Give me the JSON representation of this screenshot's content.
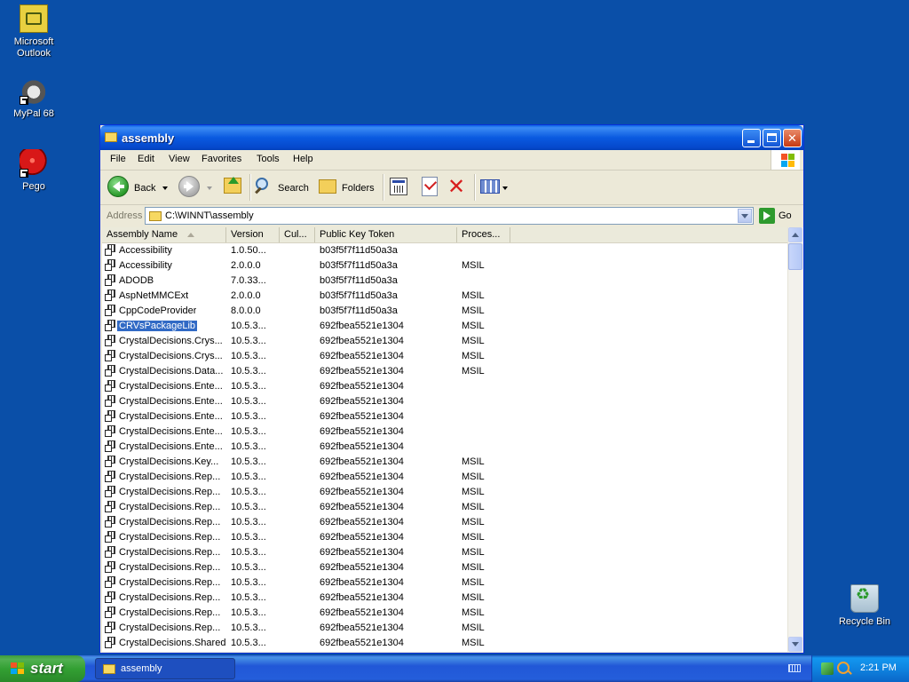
{
  "desktop": {
    "icons": [
      {
        "label_line1": "Microsoft",
        "label_line2": "Outlook"
      },
      {
        "label_line1": "MyPal 68",
        "label_line2": ""
      },
      {
        "label_line1": "Pego",
        "label_line2": ""
      },
      {
        "label_line1": "Recycle Bin",
        "label_line2": ""
      }
    ]
  },
  "window": {
    "title": "assembly",
    "menu": [
      "File",
      "Edit",
      "View",
      "Favorites",
      "Tools",
      "Help"
    ],
    "toolbar": {
      "back": "Back",
      "search": "Search",
      "folders": "Folders"
    },
    "address": {
      "label": "Address",
      "value": "C:\\WINNT\\assembly",
      "go": "Go"
    },
    "columns": [
      "Assembly Name",
      "Version",
      "Cul...",
      "Public Key Token",
      "Proces..."
    ],
    "rows": [
      {
        "name": "Accessibility",
        "version": "1.0.50...",
        "culture": "",
        "token": "b03f5f7f11d50a3a",
        "proc": ""
      },
      {
        "name": "Accessibility",
        "version": "2.0.0.0",
        "culture": "",
        "token": "b03f5f7f11d50a3a",
        "proc": "MSIL"
      },
      {
        "name": "ADODB",
        "version": "7.0.33...",
        "culture": "",
        "token": "b03f5f7f11d50a3a",
        "proc": ""
      },
      {
        "name": "AspNetMMCExt",
        "version": "2.0.0.0",
        "culture": "",
        "token": "b03f5f7f11d50a3a",
        "proc": "MSIL"
      },
      {
        "name": "CppCodeProvider",
        "version": "8.0.0.0",
        "culture": "",
        "token": "b03f5f7f11d50a3a",
        "proc": "MSIL"
      },
      {
        "name": "CRVsPackageLib",
        "version": "10.5.3...",
        "culture": "",
        "token": "692fbea5521e1304",
        "proc": "MSIL",
        "selected": true
      },
      {
        "name": "CrystalDecisions.Crys...",
        "version": "10.5.3...",
        "culture": "",
        "token": "692fbea5521e1304",
        "proc": "MSIL"
      },
      {
        "name": "CrystalDecisions.Crys...",
        "version": "10.5.3...",
        "culture": "",
        "token": "692fbea5521e1304",
        "proc": "MSIL"
      },
      {
        "name": "CrystalDecisions.Data...",
        "version": "10.5.3...",
        "culture": "",
        "token": "692fbea5521e1304",
        "proc": "MSIL"
      },
      {
        "name": "CrystalDecisions.Ente...",
        "version": "10.5.3...",
        "culture": "",
        "token": "692fbea5521e1304",
        "proc": ""
      },
      {
        "name": "CrystalDecisions.Ente...",
        "version": "10.5.3...",
        "culture": "",
        "token": "692fbea5521e1304",
        "proc": ""
      },
      {
        "name": "CrystalDecisions.Ente...",
        "version": "10.5.3...",
        "culture": "",
        "token": "692fbea5521e1304",
        "proc": ""
      },
      {
        "name": "CrystalDecisions.Ente...",
        "version": "10.5.3...",
        "culture": "",
        "token": "692fbea5521e1304",
        "proc": ""
      },
      {
        "name": "CrystalDecisions.Ente...",
        "version": "10.5.3...",
        "culture": "",
        "token": "692fbea5521e1304",
        "proc": ""
      },
      {
        "name": "CrystalDecisions.Key...",
        "version": "10.5.3...",
        "culture": "",
        "token": "692fbea5521e1304",
        "proc": "MSIL"
      },
      {
        "name": "CrystalDecisions.Rep...",
        "version": "10.5.3...",
        "culture": "",
        "token": "692fbea5521e1304",
        "proc": "MSIL"
      },
      {
        "name": "CrystalDecisions.Rep...",
        "version": "10.5.3...",
        "culture": "",
        "token": "692fbea5521e1304",
        "proc": "MSIL"
      },
      {
        "name": "CrystalDecisions.Rep...",
        "version": "10.5.3...",
        "culture": "",
        "token": "692fbea5521e1304",
        "proc": "MSIL"
      },
      {
        "name": "CrystalDecisions.Rep...",
        "version": "10.5.3...",
        "culture": "",
        "token": "692fbea5521e1304",
        "proc": "MSIL"
      },
      {
        "name": "CrystalDecisions.Rep...",
        "version": "10.5.3...",
        "culture": "",
        "token": "692fbea5521e1304",
        "proc": "MSIL"
      },
      {
        "name": "CrystalDecisions.Rep...",
        "version": "10.5.3...",
        "culture": "",
        "token": "692fbea5521e1304",
        "proc": "MSIL"
      },
      {
        "name": "CrystalDecisions.Rep...",
        "version": "10.5.3...",
        "culture": "",
        "token": "692fbea5521e1304",
        "proc": "MSIL"
      },
      {
        "name": "CrystalDecisions.Rep...",
        "version": "10.5.3...",
        "culture": "",
        "token": "692fbea5521e1304",
        "proc": "MSIL"
      },
      {
        "name": "CrystalDecisions.Rep...",
        "version": "10.5.3...",
        "culture": "",
        "token": "692fbea5521e1304",
        "proc": "MSIL"
      },
      {
        "name": "CrystalDecisions.Rep...",
        "version": "10.5.3...",
        "culture": "",
        "token": "692fbea5521e1304",
        "proc": "MSIL"
      },
      {
        "name": "CrystalDecisions.Rep...",
        "version": "10.5.3...",
        "culture": "",
        "token": "692fbea5521e1304",
        "proc": "MSIL"
      },
      {
        "name": "CrystalDecisions.Shared",
        "version": "10.5.3...",
        "culture": "",
        "token": "692fbea5521e1304",
        "proc": "MSIL"
      }
    ]
  },
  "taskbar": {
    "start": "start",
    "task": "assembly",
    "clock": "2:21 PM"
  },
  "colors": {
    "desktop": "#0a4fa8",
    "titlebar": "#0a5ae0",
    "selection": "#316ac5",
    "start": "#33a033"
  }
}
